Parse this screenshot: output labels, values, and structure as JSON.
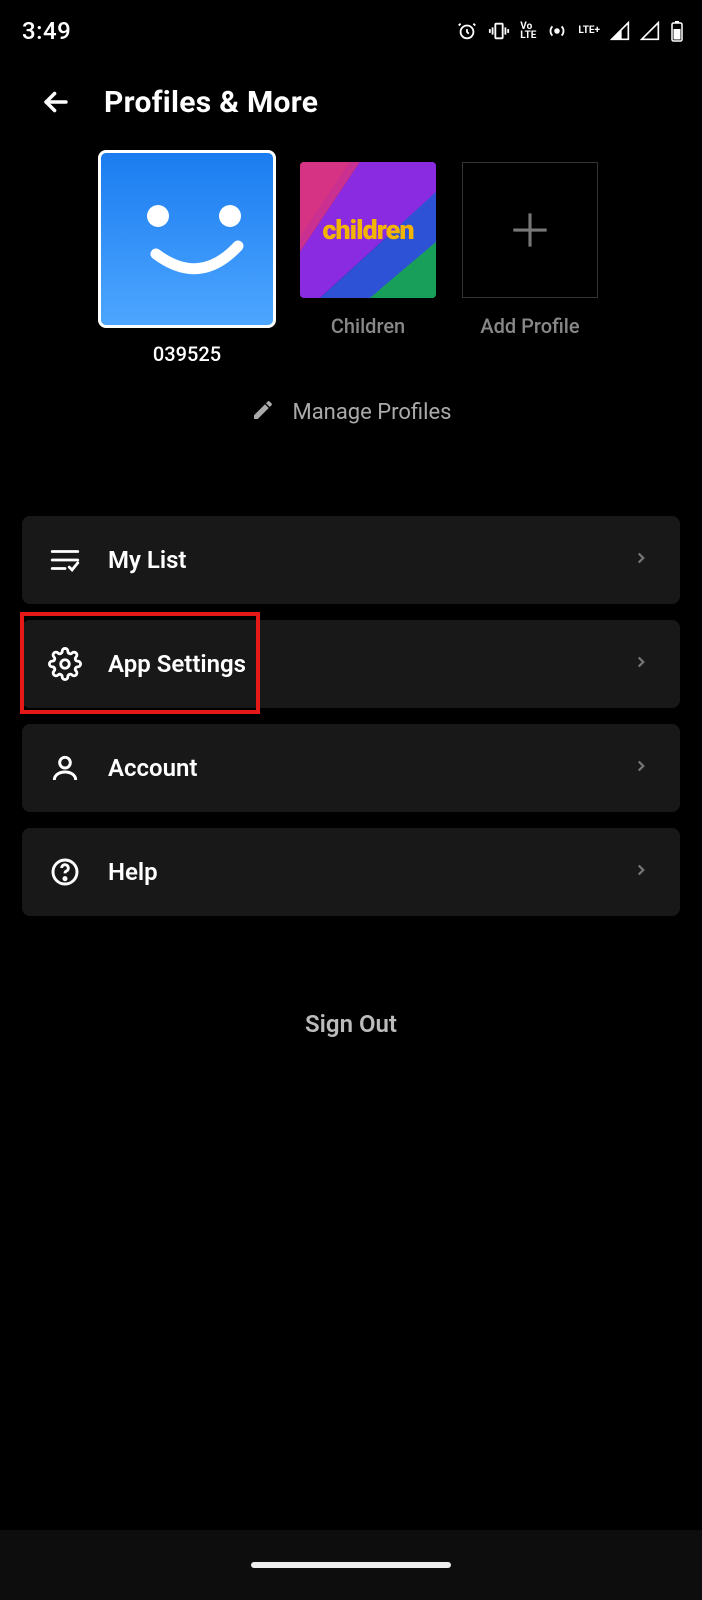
{
  "status": {
    "time": "3:49",
    "network_label": "LTE+",
    "volte_label": "Vo\nLTE"
  },
  "header": {
    "title": "Profiles & More"
  },
  "profiles": [
    {
      "name": "039525",
      "type": "smiley",
      "selected": true
    },
    {
      "name": "Children",
      "type": "children",
      "selected": false
    },
    {
      "name": "Add Profile",
      "type": "add",
      "selected": false
    }
  ],
  "manage": {
    "label": "Manage Profiles"
  },
  "menu": [
    {
      "label": "My List",
      "icon": "list",
      "highlighted": false
    },
    {
      "label": "App Settings",
      "icon": "gear",
      "highlighted": true
    },
    {
      "label": "Account",
      "icon": "person",
      "highlighted": false
    },
    {
      "label": "Help",
      "icon": "help",
      "highlighted": false
    }
  ],
  "signout": {
    "label": "Sign Out"
  }
}
